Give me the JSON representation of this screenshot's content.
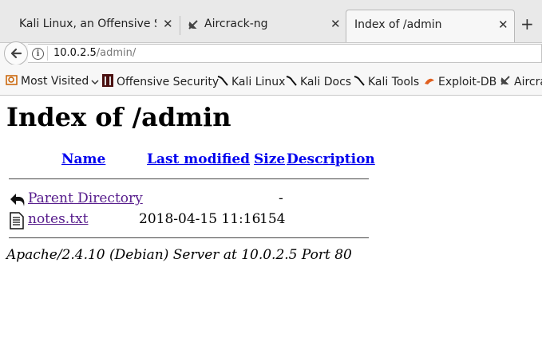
{
  "tabs": [
    {
      "title": "Kali Linux, an Offensive S...",
      "icon": "none"
    },
    {
      "title": "Aircrack-ng",
      "icon": "satellite-dish-icon"
    },
    {
      "title": "Index of /admin",
      "icon": "none",
      "active": true
    }
  ],
  "url": {
    "host": "10.0.2.5",
    "path": "/admin/"
  },
  "bookmarks": [
    {
      "label": "Most Visited",
      "icon": "most-visited-icon"
    },
    {
      "label": "Offensive Security",
      "icon": "offsec-icon"
    },
    {
      "label": "Kali Linux",
      "icon": "kali-dragon-icon"
    },
    {
      "label": "Kali Docs",
      "icon": "kali-dragon-icon"
    },
    {
      "label": "Kali Tools",
      "icon": "kali-dragon-icon"
    },
    {
      "label": "Exploit-DB",
      "icon": "exploitdb-icon"
    },
    {
      "label": "Aircra",
      "icon": "satellite-dish-icon"
    }
  ],
  "page": {
    "title": "Index of /admin",
    "columns": [
      "Name",
      "Last modified",
      "Size",
      "Description"
    ],
    "rows": [
      {
        "name": "Parent Directory",
        "modified": "",
        "size": "-",
        "description": "",
        "icon": "back-folder-icon"
      },
      {
        "name": "notes.txt",
        "modified": "2018-04-15 11:16",
        "size": "154",
        "description": "",
        "icon": "text-file-icon"
      }
    ],
    "address": "Apache/2.4.10 (Debian) Server at 10.0.2.5 Port 80"
  }
}
